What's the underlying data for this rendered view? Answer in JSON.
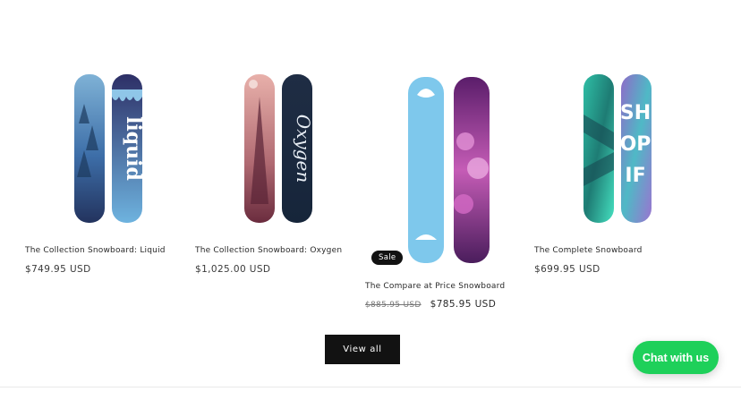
{
  "products": [
    {
      "title": "The Collection Snowboard: Liquid",
      "price": "$749.95 USD"
    },
    {
      "title": "The Collection Snowboard: Oxygen",
      "price": "$1,025.00 USD"
    },
    {
      "title": "The Compare at Price Snowboard",
      "badge": "Sale",
      "compare_price": "$885.95 USD",
      "price": "$785.95 USD"
    },
    {
      "title": "The Complete Snowboard",
      "price": "$699.95 USD"
    }
  ],
  "view_all_label": "View all",
  "chat_label": "Chat with us",
  "colors": {
    "button_dark": "#121212",
    "chat_green": "#1ed05a"
  }
}
